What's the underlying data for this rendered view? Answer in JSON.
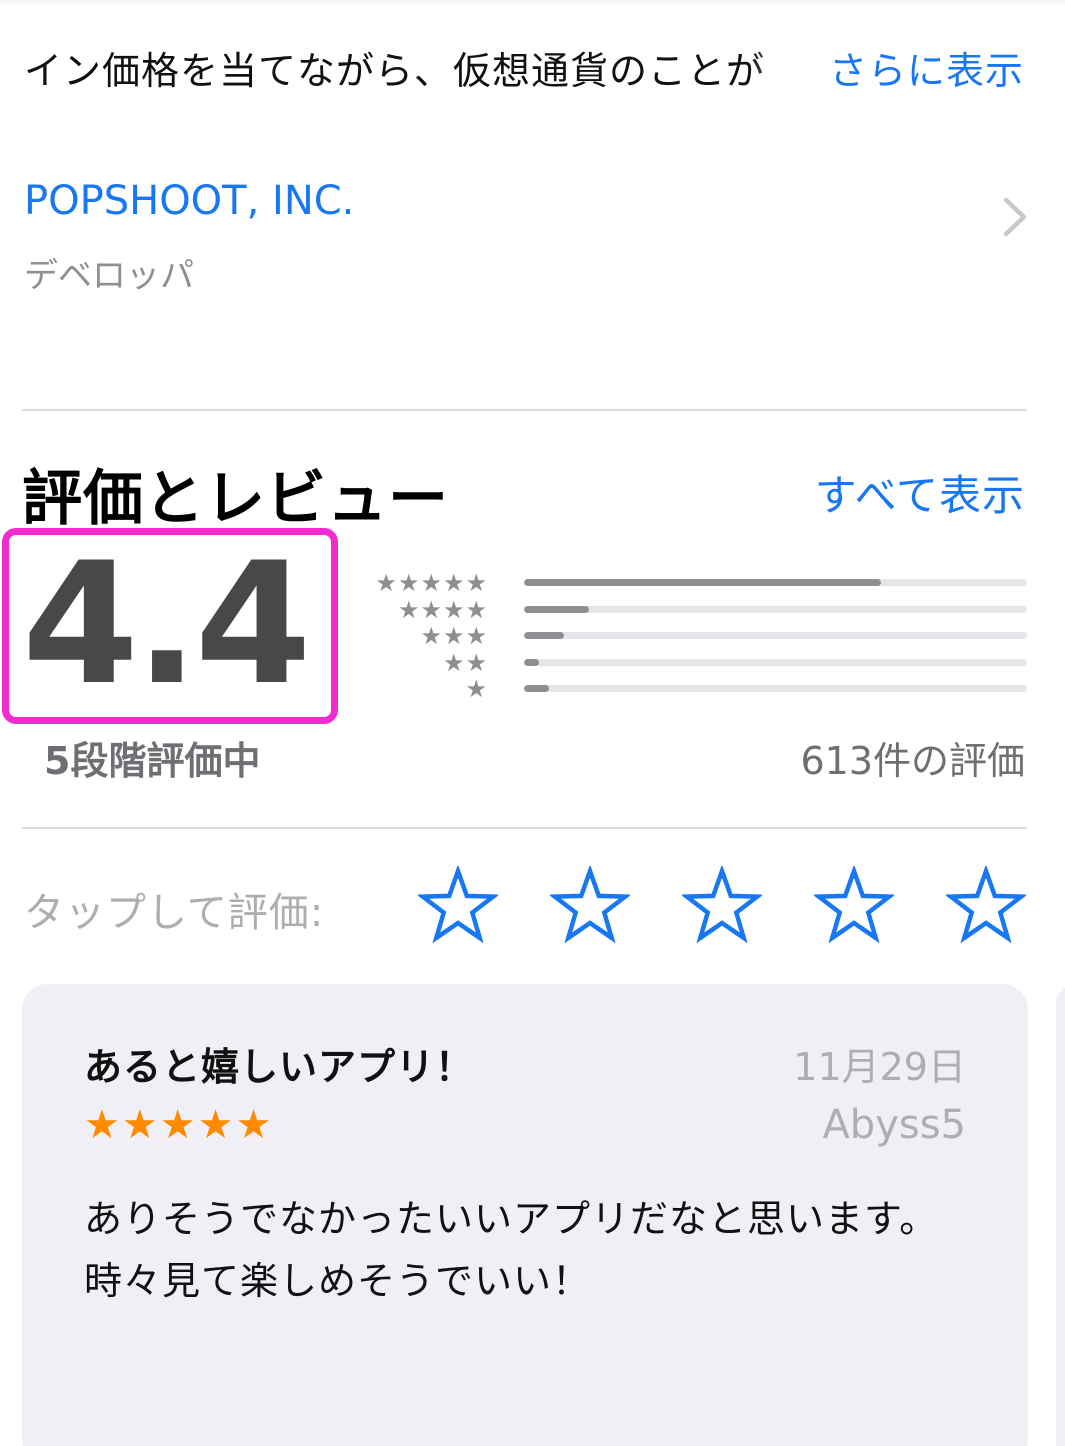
{
  "description": {
    "text": "イン価格を当てながら、仮想通貨のことが",
    "more_label": "さらに表示"
  },
  "developer": {
    "name": "POPSHOOT, INC.",
    "role": "デベロッパ"
  },
  "ratings": {
    "title": "評価とレビュー",
    "see_all_label": "すべて表示",
    "average": "4.4",
    "out_of": "5段階評価中",
    "count_label": "613件の評価",
    "histogram": [
      {
        "stars": "★★★★★",
        "fraction": 0.71
      },
      {
        "stars": "★★★★",
        "fraction": 0.13
      },
      {
        "stars": "★★★",
        "fraction": 0.08
      },
      {
        "stars": "★★",
        "fraction": 0.03
      },
      {
        "stars": "★",
        "fraction": 0.05
      }
    ]
  },
  "tap_to_rate": {
    "label": "タップして評価:",
    "star_count": 5
  },
  "review": {
    "title": "あると嬉しいアプリ！",
    "date": "11月29日",
    "stars": "★★★★★",
    "author": "Abyss5",
    "body": "ありそうでなかったいいアプリだなと思います。時々見て楽しめそうでいい！"
  },
  "colors": {
    "link": "#1877f2",
    "highlight": "#f12bd0",
    "review_star": "#ff8a00",
    "bar_fill": "#8e8e93",
    "bar_track": "#e5e5ea"
  },
  "icons": {
    "developer_chevron": "chevron-right-icon",
    "tap_star": "star-outline-icon"
  }
}
